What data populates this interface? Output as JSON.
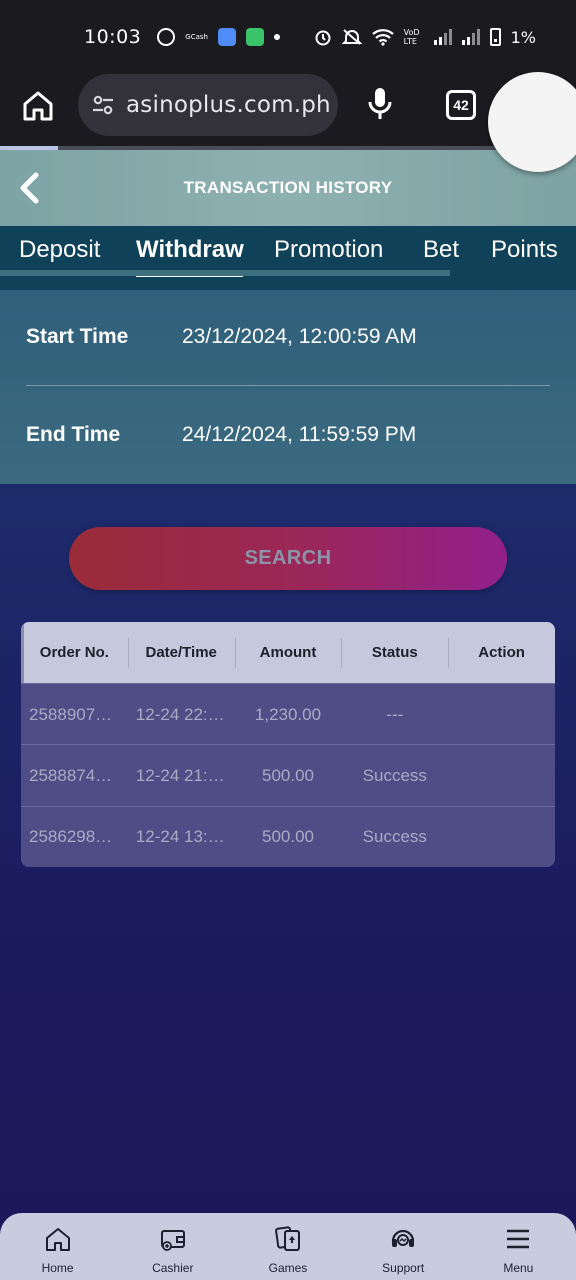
{
  "status_bar": {
    "time": "10:03",
    "gcash_label": "GCash",
    "battery": "1%",
    "network_label": "VoD LTE"
  },
  "browser": {
    "url": "asinoplus.com.ph",
    "tab_count": "42"
  },
  "header": {
    "title": "TRANSACTION HISTORY"
  },
  "tabs": [
    {
      "label": "Deposit"
    },
    {
      "label": "Withdraw"
    },
    {
      "label": "Promotion"
    },
    {
      "label": "Bet"
    },
    {
      "label": "Points"
    }
  ],
  "active_tab": "Withdraw",
  "filters": {
    "start_label": "Start Time",
    "start_value": "23/12/2024, 12:00:59 AM",
    "end_label": "End Time",
    "end_value": "24/12/2024, 11:59:59 PM"
  },
  "search_label": "SEARCH",
  "table": {
    "columns": [
      "Order No.",
      "Date/Time",
      "Amount",
      "Status",
      "Action"
    ],
    "rows": [
      [
        "2588907…",
        "12-24 22:…",
        "1,230.00",
        "---",
        ""
      ],
      [
        "2588874…",
        "12-24 21:…",
        "500.00",
        "Success",
        ""
      ],
      [
        "2586298…",
        "12-24 13:…",
        "500.00",
        "Success",
        ""
      ]
    ]
  },
  "bottom_nav": [
    {
      "label": "Home",
      "icon": "home-icon"
    },
    {
      "label": "Cashier",
      "icon": "wallet-icon"
    },
    {
      "label": "Games",
      "icon": "cards-icon"
    },
    {
      "label": "Support",
      "icon": "headset-icon"
    },
    {
      "label": "Menu",
      "icon": "menu-icon"
    }
  ],
  "colors": {
    "header_bg": "#8eb0b0",
    "tab_bg": "#0f4158",
    "search_gradient_start": "#9a2b38",
    "search_gradient_end": "#921f8c",
    "table_header_bg": "#c6c9dd",
    "nav_bg": "#c9cbde"
  }
}
